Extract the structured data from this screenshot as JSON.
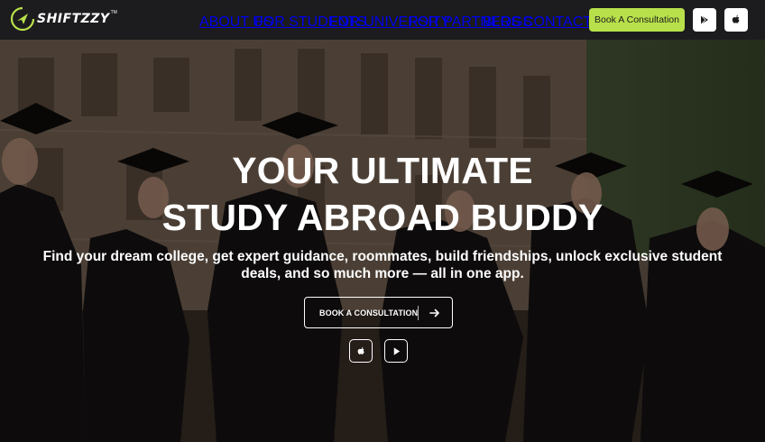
{
  "brand": {
    "name": "SHIFTZZY",
    "tm": "TM",
    "accent": "#b8e04a"
  },
  "nav": {
    "items": [
      {
        "label": "ABOUT US"
      },
      {
        "label": "FOR STUDENTS"
      },
      {
        "label": "FOR UNIVERSITY"
      },
      {
        "label": "FOR PARTNERS"
      },
      {
        "label": "BLOGS"
      },
      {
        "label": "CONTACT US"
      }
    ],
    "cta_label": "Book A Consultation",
    "store_icons": [
      "google-play-icon",
      "apple-icon"
    ]
  },
  "hero": {
    "title_line1": "YOUR ULTIMATE",
    "title_line2": "STUDY ABROAD BUDDY",
    "subtitle_line1": "Find your dream college, get expert guidance, roommates, build friendships, unlock exclusive student",
    "subtitle_line2": "deals, and so much more — all in one app.",
    "cta_label": "BOOK A CONSULTATION",
    "cta_icon": "arrow-right-icon",
    "store_icons": [
      "apple-icon",
      "play-icon"
    ]
  }
}
